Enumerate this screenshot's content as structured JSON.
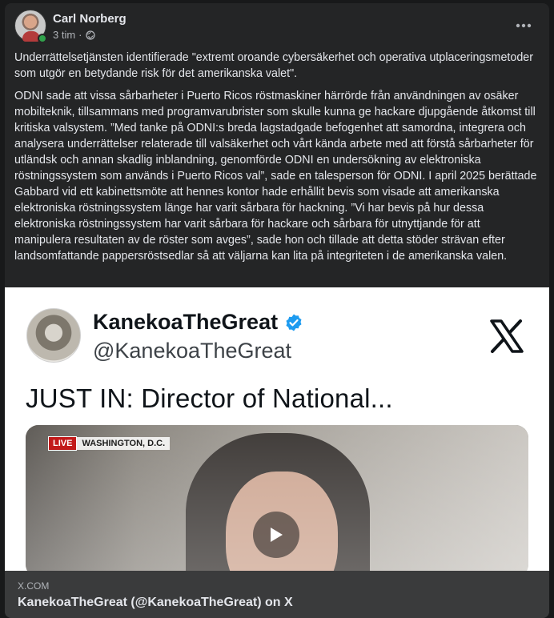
{
  "post": {
    "author": "Carl Norberg",
    "time": "3 tim",
    "separator": "·",
    "privacy_icon": "globe-icon",
    "more_icon": "more-horizontal-icon",
    "paragraph1": "Underrättelsetjänsten identifierade \"extremt oroande cybersäkerhet och operativa utplaceringsmetoder som utgör en betydande risk för det amerikanska valet\".",
    "paragraph2": "ODNI sade att vissa sårbarheter i Puerto Ricos röstmaskiner härrörde från användningen av osäker mobilteknik, tillsammans med programvarubrister som skulle kunna ge hackare djupgående åtkomst till kritiska valsystem. ”Med tanke på ODNI:s breda lagstadgade befogenhet att samordna, integrera och analysera underrättelser relaterade till valsäkerhet och vårt kända arbete med att förstå sårbarheter för utländsk och annan skadlig inblandning, genomförde ODNI en undersökning av elektroniska röstningssystem som används i Puerto Ricos val”, sade en talesperson för ODNI. I april 2025 berättade Gabbard vid ett kabinettsmöte att hennes kontor hade erhållit bevis som visade att amerikanska elektroniska röstningssystem länge har varit sårbara för hackning. ”Vi har bevis på hur dessa elektroniska röstningssystem har varit sårbara för hackare och sårbara för utnyttjande för att manipulera resultaten av de röster som avges”, sade hon och tillade att detta stöder strävan efter landsomfattande pappersröstsedlar så att väljarna kan lita på integriteten i de amerikanska valen."
  },
  "media": {
    "display_name": "KanekoaTheGreat",
    "handle": "@KanekoaTheGreat",
    "headline": "JUST IN: Director of National...",
    "live_label": "LIVE",
    "location": "WASHINGTON, D.C.",
    "verified_color": "#1d9bf0"
  },
  "link": {
    "domain": "X.COM",
    "title": "KanekoaTheGreat (@KanekoaTheGreat) on X"
  }
}
